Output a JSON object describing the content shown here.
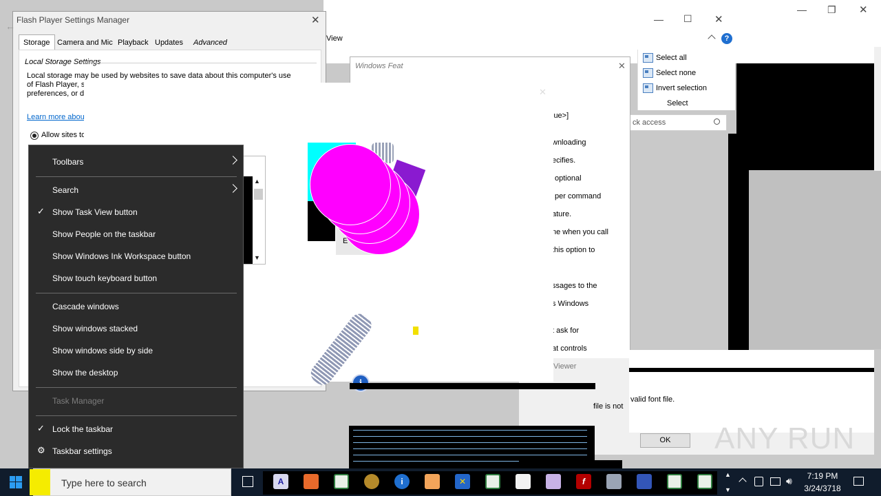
{
  "desktop": {
    "background": "#c9c9c9"
  },
  "explorer_bg": {
    "title_buttons": {
      "minimize": "—",
      "maximize": "☐",
      "restore": "❐",
      "close": "✕"
    },
    "ribbon": {
      "tab_view": "View",
      "select_all": "Select all",
      "select_none": "Select none",
      "invert_selection": "Invert selection",
      "group_label": "Select"
    },
    "search_placeholder": "ck access",
    "help": "?"
  },
  "flash_settings": {
    "title": "Flash Player Settings Manager",
    "tabs": [
      "Storage",
      "Camera and Mic",
      "Playback",
      "Updates",
      "Advanced"
    ],
    "active_tab": "Storage",
    "section_title": "Local Storage Settings",
    "description_line1": "Local storage may be used by websites to save data about this computer's use",
    "description_line2": "of Flash Player, s",
    "description_line3": "preferences, or d",
    "learn_more": "Learn more about",
    "radio_allow": "Allow sites to"
  },
  "windows_features": {
    "title": "Windows Feat",
    "lines": [
      "lue>]",
      "wnloading",
      "ecifies.",
      "optional",
      "per command",
      "ature.",
      "ne when you call",
      "this option to",
      "ssages to the",
      "s Windows",
      "t ask for",
      "at controls"
    ]
  },
  "viewer": {
    "title_fragment": "Viewer",
    "message_fragment": "valid font file.",
    "message_fragment2": "file  is not",
    "ok_button": "OK"
  },
  "dialog_fragment": {
    "left_label": "E"
  },
  "context_menu": {
    "items": [
      {
        "label": "Toolbars",
        "submenu": true
      },
      {
        "label": "Search",
        "submenu": true
      },
      {
        "label": "Show Task View button",
        "checked": true
      },
      {
        "label": "Show People on the taskbar"
      },
      {
        "label": "Show Windows Ink Workspace button"
      },
      {
        "label": "Show touch keyboard button"
      },
      {
        "label": "Cascade windows"
      },
      {
        "label": "Show windows stacked"
      },
      {
        "label": "Show windows side by side"
      },
      {
        "label": "Show the desktop"
      },
      {
        "label": "Task Manager",
        "disabled": true
      },
      {
        "label": "Lock the taskbar",
        "checked": true
      },
      {
        "label": "Taskbar settings",
        "icon": "gear-icon"
      }
    ]
  },
  "taskbar": {
    "search_placeholder": "Type here to search",
    "time": "7:19 PM",
    "date": "3/24/3718",
    "icons": [
      "task-view-icon",
      "font-app-icon",
      "office-icon",
      "spreadsheet-icon",
      "media-icon",
      "info-icon",
      "video-icon",
      "xbox-icon",
      "table-icon",
      "edit-icon",
      "archive-icon",
      "flash-icon",
      "files-icon",
      "apps-icon",
      "table2-icon",
      "table3-icon"
    ]
  },
  "watermark": {
    "text": "ANY RUN"
  },
  "colors": {
    "magenta": "#ff00ff",
    "cyan": "#00ffff",
    "purple": "#8a1ad0",
    "menu_bg": "#2b2b2b",
    "taskbar_bg": "#101c2c",
    "link_blue": "#0066cc",
    "info_blue": "#1f5fc2"
  }
}
